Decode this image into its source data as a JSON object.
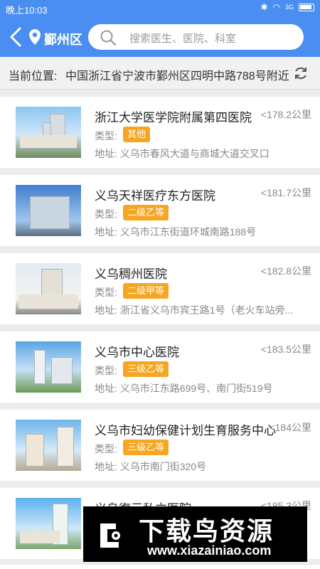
{
  "status_bar": {
    "time": "晚上10:03",
    "network": "3G"
  },
  "header": {
    "location": "鄞州区",
    "search_placeholder": "搜索医生、医院、科室"
  },
  "location_bar": {
    "label": "当前位置:",
    "address": "中国浙江省宁波市鄞州区四明中路788号附近"
  },
  "hospitals": [
    {
      "name": "浙江大学医学院附属第四医院",
      "distance": "<178.2公里",
      "type_label": "类型:",
      "type": "其他",
      "address_label": "地址:",
      "address": "义乌市春风大道与商城大道交叉口"
    },
    {
      "name": "义乌天祥医疗东方医院",
      "distance": "<181.7公里",
      "type_label": "类型:",
      "type": "二级乙等",
      "address_label": "地址:",
      "address": "义乌市江东街道环城南路188号"
    },
    {
      "name": "义乌稠州医院",
      "distance": "<182.8公里",
      "type_label": "类型:",
      "type": "二级甲等",
      "address_label": "地址:",
      "address": "浙江省义乌市宾王路1号（老火车站旁..."
    },
    {
      "name": "义乌市中心医院",
      "distance": "<183.5公里",
      "type_label": "类型:",
      "type": "三级乙等",
      "address_label": "地址:",
      "address": "义乌市江东路699号、南门街519号"
    },
    {
      "name": "义乌市妇幼保健计划生育服务中心",
      "distance": "<184公里",
      "type_label": "类型:",
      "type": "三级乙等",
      "address_label": "地址:",
      "address": "义乌市南门街320号"
    },
    {
      "name": "义乌復元私立医院",
      "distance": "<185.3公里",
      "type_label": "",
      "type": "",
      "address_label": "",
      "address": ""
    }
  ],
  "watermark": {
    "title": "下载鸟资源",
    "url": "www.xiazainiao.com"
  }
}
